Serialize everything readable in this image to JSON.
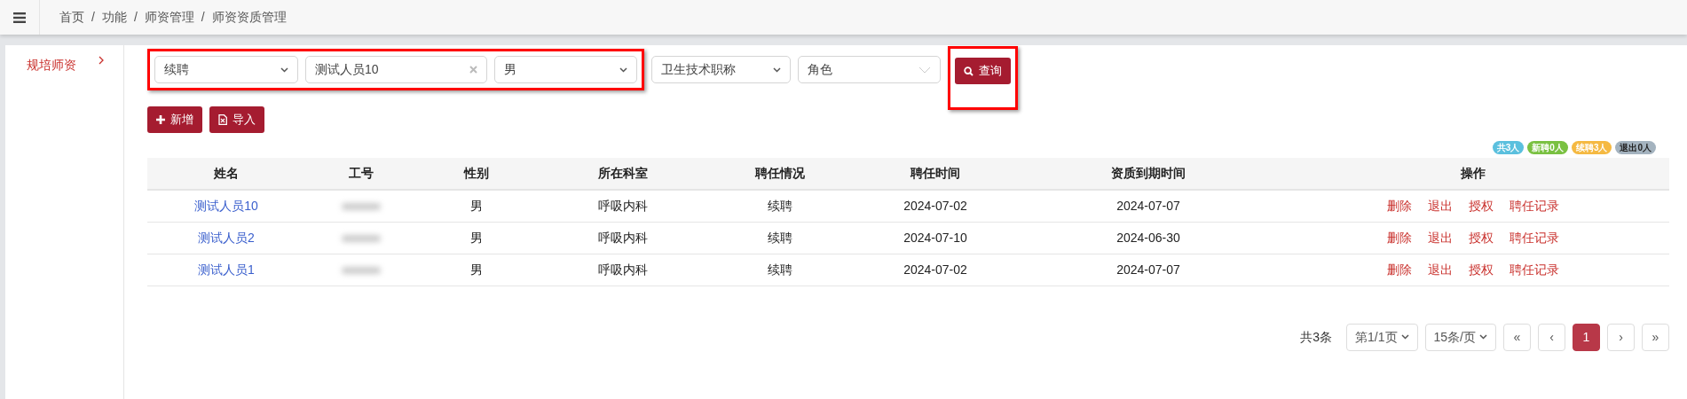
{
  "breadcrumb": [
    "首页",
    "功能",
    "师资管理",
    "师资资质管理"
  ],
  "breadcrumb_separator": "/",
  "sidebar": [
    {
      "label": "规培师资",
      "selected": true
    }
  ],
  "filters": [
    {
      "kind": "select",
      "value": "续聘",
      "highlighted": true
    },
    {
      "kind": "input",
      "value": "测试人员10",
      "highlighted": true
    },
    {
      "kind": "select",
      "value": "男",
      "highlighted": true
    },
    {
      "kind": "select",
      "value": "卫生技术职称",
      "highlighted": false
    },
    {
      "kind": "multiselect",
      "value": "角色",
      "highlighted": false
    }
  ],
  "search_button": {
    "label": "查询",
    "highlighted": true
  },
  "actions": [
    {
      "kind": "add",
      "label": "新增"
    },
    {
      "kind": "import",
      "label": "导入"
    }
  ],
  "badges": [
    {
      "label": "共3人",
      "color": "#5bc0de"
    },
    {
      "label": "新聘0人",
      "color": "#7ac142"
    },
    {
      "label": "续聘3人",
      "color": "#f5b942"
    },
    {
      "label": "退出0人",
      "color": "#a4b3bf"
    }
  ],
  "table": {
    "columns": [
      "姓名",
      "工号",
      "性别",
      "所在科室",
      "聘任情况",
      "聘任时间",
      "资质到期时间",
      "操作"
    ],
    "rows": [
      {
        "name": "测试人员10",
        "gender": "男",
        "department": "呼吸内科",
        "status": "续聘",
        "start": "2024-07-02",
        "expiry": "2024-07-07",
        "operations": [
          "删除",
          "退出",
          "授权",
          "聘任记录"
        ]
      },
      {
        "name": "测试人员2",
        "gender": "男",
        "department": "呼吸内科",
        "status": "续聘",
        "start": "2024-07-10",
        "expiry": "2024-06-30",
        "operations": [
          "删除",
          "退出",
          "授权",
          "聘任记录"
        ]
      },
      {
        "name": "测试人员1",
        "gender": "男",
        "department": "呼吸内科",
        "status": "续聘",
        "start": "2024-07-02",
        "expiry": "2024-07-07",
        "operations": [
          "删除",
          "退出",
          "授权",
          "聘任记录"
        ]
      }
    ]
  },
  "pagination": {
    "total": "共3条",
    "page_select": "第1/1页",
    "size_select": "15条/页",
    "pages": [
      {
        "label": "«",
        "selected": false
      },
      {
        "label": "‹",
        "selected": false
      },
      {
        "label": "1",
        "selected": true
      },
      {
        "label": "›",
        "selected": false
      },
      {
        "label": "»",
        "selected": false
      }
    ]
  }
}
